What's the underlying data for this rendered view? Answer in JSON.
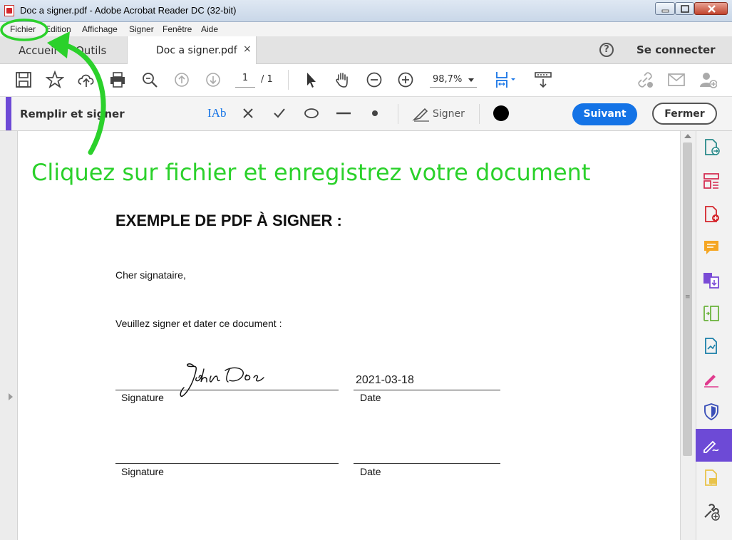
{
  "window": {
    "title": "Doc a signer.pdf - Adobe Acrobat Reader DC (32-bit)"
  },
  "menu": {
    "items": [
      "Fichier",
      "Edition",
      "Affichage",
      "Signer",
      "Fenêtre",
      "Aide"
    ]
  },
  "tabs": {
    "home": "Accueil",
    "tools": "Outils",
    "document": "Doc a signer.pdf",
    "close": "×",
    "help": "?",
    "login": "Se connecter"
  },
  "toolbar": {
    "page_current": "1",
    "page_total": "/ 1",
    "zoom": "98,7%",
    "icons": [
      "save-icon",
      "star-icon",
      "cloud-upload-icon",
      "print-icon",
      "zoom-search-icon",
      "page-up-icon",
      "page-down-icon",
      "select-cursor-icon",
      "hand-icon",
      "zoom-out-icon",
      "zoom-in-icon",
      "fit-page-icon",
      "read-mode-icon",
      "link-icon",
      "mail-icon",
      "add-user-icon"
    ]
  },
  "fill_sign": {
    "title": "Remplir et signer",
    "text_tool": "IAb",
    "sign_label": "Signer",
    "next_button": "Suivant",
    "close_button": "Fermer",
    "ink_color": "#000000"
  },
  "annotation": {
    "text": "Cliquez sur fichier et enregistrez votre document",
    "color": "#2bd12b"
  },
  "document": {
    "heading": "EXEMPLE DE PDF À SIGNER :",
    "greeting": "Cher signataire,",
    "instruction": "Veuillez signer et dater ce document :",
    "signature_name": "John Doe",
    "date_value": "2021-03-18",
    "label_signature_1": "Signature",
    "label_date_1": "Date",
    "label_signature_2": "Signature",
    "label_date_2": "Date"
  },
  "right_panel": {
    "icons": [
      "export-pdf-icon",
      "organize-pages-icon",
      "create-pdf-icon",
      "comment-icon",
      "combine-files-icon",
      "compress-pdf-icon",
      "edit-pdf-icon",
      "fill-sign-pen-icon",
      "protect-shield-icon",
      "signature-active-icon",
      "send-comments-icon",
      "more-tools-icon"
    ]
  },
  "colors": {
    "accent_purple": "#6d4ad6",
    "primary_blue": "#1473e6"
  }
}
